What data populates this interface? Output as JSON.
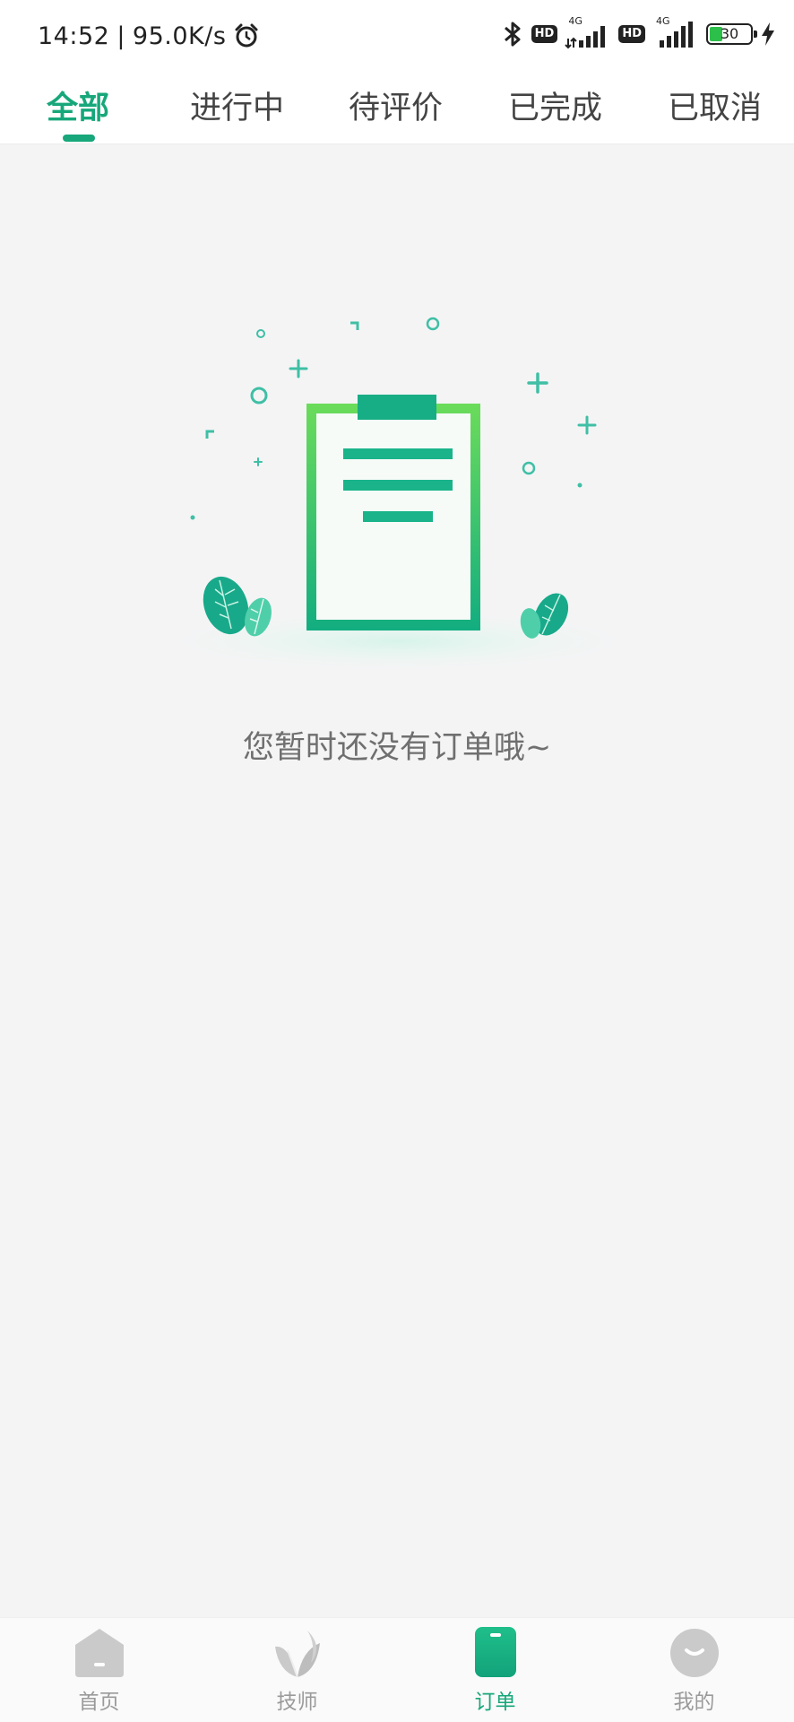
{
  "status_bar": {
    "time": "14:52",
    "separator": "|",
    "net_speed": "95.0K/s",
    "alarm_icon": "alarm-clock-icon",
    "bluetooth_icon": "bluetooth-icon",
    "hd_label_1": "HD",
    "network_1": "4G",
    "hd_label_2": "HD",
    "network_2": "4G",
    "battery_level": "30",
    "charging_icon": "charging-bolt-icon"
  },
  "tabs": [
    {
      "label": "全部",
      "active": true
    },
    {
      "label": "进行中",
      "active": false
    },
    {
      "label": "待评价",
      "active": false
    },
    {
      "label": "已完成",
      "active": false
    },
    {
      "label": "已取消",
      "active": false
    }
  ],
  "empty_state": {
    "message": "您暂时还没有订单哦~",
    "illustration_icon": "empty-clipboard-icon"
  },
  "bottom_nav": [
    {
      "label": "首页",
      "icon": "home-icon",
      "active": false
    },
    {
      "label": "技师",
      "icon": "technician-leaf-icon",
      "active": false
    },
    {
      "label": "订单",
      "icon": "order-icon",
      "active": true
    },
    {
      "label": "我的",
      "icon": "profile-smile-icon",
      "active": false
    }
  ],
  "colors": {
    "accent": "#17a77a",
    "accent_light": "#6bdc5a",
    "inactive": "#9a9a9a",
    "background": "#f4f4f5"
  }
}
